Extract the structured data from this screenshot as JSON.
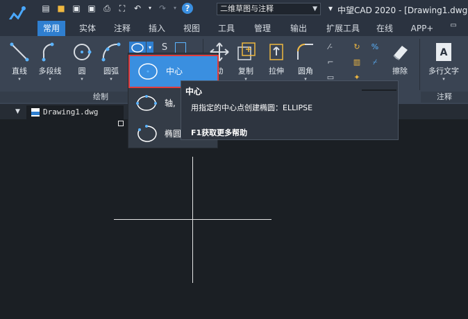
{
  "title_bar": {
    "workspace": "二维草图与注释",
    "app_title": "中望CAD 2020 - [Drawing1.dwg]"
  },
  "tabs": [
    {
      "label": "常用",
      "active": true
    },
    {
      "label": "实体"
    },
    {
      "label": "注释"
    },
    {
      "label": "插入"
    },
    {
      "label": "视图"
    },
    {
      "label": "工具"
    },
    {
      "label": "管理"
    },
    {
      "label": "输出"
    },
    {
      "label": "扩展工具"
    },
    {
      "label": "在线"
    },
    {
      "label": "APP+"
    }
  ],
  "ribbon": {
    "draw_tools": [
      {
        "label": "直线",
        "icon": "line-icon"
      },
      {
        "label": "多段线",
        "icon": "polyline-icon"
      },
      {
        "label": "圆",
        "icon": "circle-icon"
      },
      {
        "label": "圆弧",
        "icon": "arc-icon"
      }
    ],
    "modify_tools": [
      {
        "label": "动",
        "icon": "move-icon"
      },
      {
        "label": "复制",
        "icon": "copy-icon"
      },
      {
        "label": "拉伸",
        "icon": "stretch-icon"
      },
      {
        "label": "圆角",
        "icon": "fillet-icon"
      }
    ],
    "erase": {
      "label": "擦除",
      "icon": "eraser-icon"
    },
    "mtext": {
      "label": "多行文字",
      "icon": "mtext-icon"
    },
    "group_labels": {
      "draw": "绘制",
      "annotate": "注释"
    }
  },
  "doc_tab": {
    "label": "Drawing1.dwg"
  },
  "ellipse_dropdown": {
    "items": [
      {
        "label": "中心",
        "icon": "ellipse-center-icon",
        "selected": true
      },
      {
        "label": "轴,",
        "icon": "ellipse-axis-icon"
      },
      {
        "label": "椭圆",
        "icon": "ellipse-arc-icon"
      }
    ]
  },
  "tooltip": {
    "title": "中心",
    "description": "用指定的中心点创建椭圆：ELLIPSE",
    "help": "F1获取更多帮助"
  },
  "colors": {
    "accent": "#2f7fd0",
    "highlight_border": "#e23c3c",
    "icon_blue": "#5bb4ff"
  }
}
